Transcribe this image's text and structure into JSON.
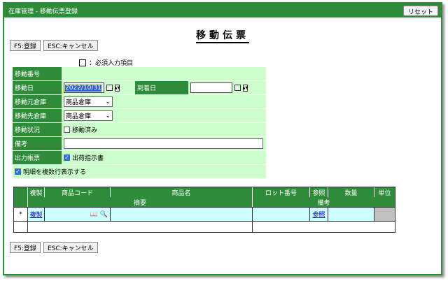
{
  "titlebar": {
    "title": "在庫管理 - 移動伝票登録",
    "reset_label": "リセット"
  },
  "page_title": "移動伝票",
  "buttons": {
    "f5_label": "F5:登録",
    "esc_label": "ESC:キャンセル"
  },
  "legend": {
    "text": "：必須入力項目"
  },
  "form": {
    "move_no_label": "移動番号",
    "move_date_label": "移動日",
    "move_date_value": "2022/10/31",
    "arrival_date_label": "到着日",
    "arrival_date_value": "",
    "from_warehouse_label": "移動元倉庫",
    "from_warehouse_value": "商品倉庫",
    "to_warehouse_label": "移動先倉庫",
    "to_warehouse_value": "商品倉庫",
    "status_label": "移動状況",
    "status_check_label": "移動済み",
    "status_checked": false,
    "remarks_label": "備考",
    "output_label": "出力帳票",
    "output_check_label": "出荷指示書",
    "output_checked": true,
    "multiline_label": "明細を複数行表示する",
    "multiline_checked": true
  },
  "detail": {
    "headers1": [
      "複製",
      "商品コード",
      "商品名",
      "ロット番号",
      "参照",
      "数量",
      "単位"
    ],
    "headers2": [
      "摘要",
      "備考"
    ],
    "row": {
      "copy_link": "複製",
      "ref_link": "参照",
      "marker": "*"
    }
  },
  "colors": {
    "accent": "#2e8b3a",
    "field_bg": "#ccffcc",
    "row_bg": "#ccffff"
  }
}
